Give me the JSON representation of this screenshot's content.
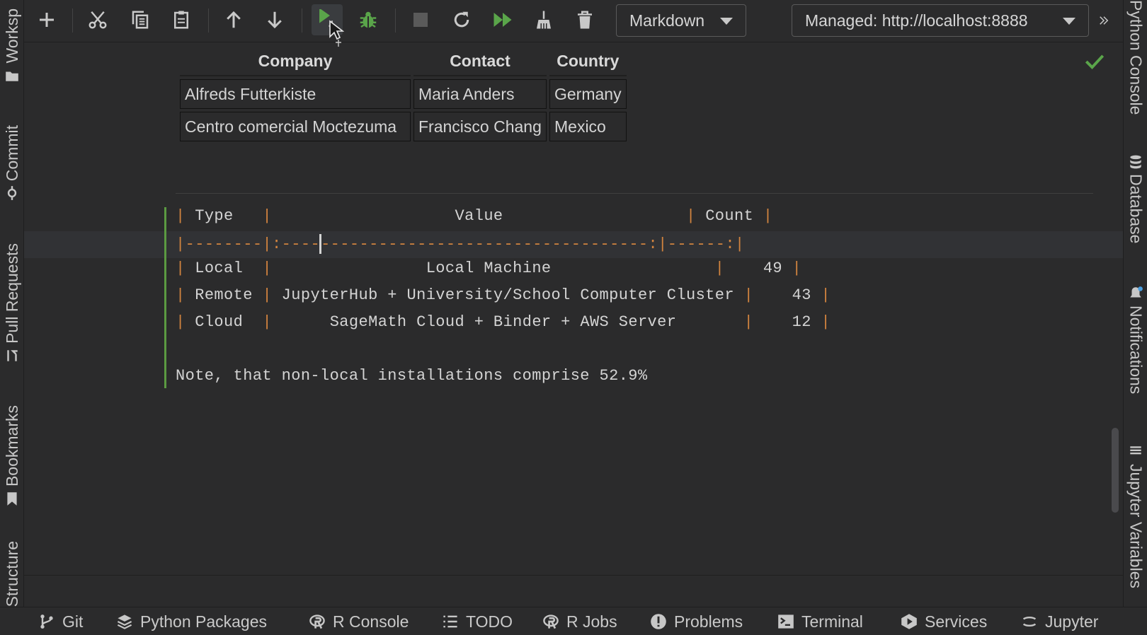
{
  "toolbar": {
    "cell_type": "Markdown",
    "kernel": "Managed: http://localhost:8888"
  },
  "left_tools": [
    "Worksp",
    "Commit",
    "Pull Requests",
    "Bookmarks",
    "Structure"
  ],
  "right_tools": [
    "Python Console",
    "Database",
    "Notifications",
    "Jupyter Variables"
  ],
  "rendered_table": {
    "headers": [
      "Company",
      "Contact",
      "Country"
    ],
    "rows": [
      [
        "Alfreds Futterkiste",
        "Maria Anders",
        "Germany"
      ],
      [
        "Centro comercial Moctezuma",
        "Francisco Chang",
        "Mexico"
      ]
    ]
  },
  "markdown_source": {
    "header": [
      "Type",
      "Value",
      "Count"
    ],
    "separator_a": "--------",
    "separator_b": ":----",
    "separator_c": "----------------------------------:",
    "separator_d": "------:",
    "rows": [
      [
        "Local",
        "Local Machine",
        "49"
      ],
      [
        "Remote",
        "JupyterHub + University/School Computer Cluster",
        "43"
      ],
      [
        "Cloud",
        "SageMath Cloud + Binder + AWS Server",
        "12"
      ]
    ],
    "note": "Note, that non-local installations comprise 52.9%"
  },
  "bottom_bar": [
    "Git",
    "Python Packages",
    "R Console",
    "TODO",
    "R Jobs",
    "Problems",
    "Terminal",
    "Services",
    "Jupyter"
  ],
  "colors": {
    "background": "#2b2b2c",
    "accent_green": "#5aa54a",
    "markdown_pipe": "#d2843f"
  }
}
